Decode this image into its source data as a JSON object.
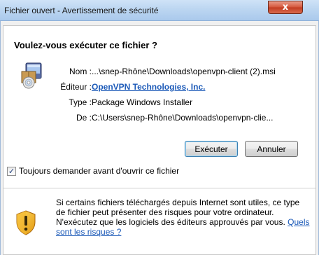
{
  "window": {
    "title": "Fichier ouvert - Avertissement de sécurité",
    "close_glyph": "x"
  },
  "dialog": {
    "heading": "Voulez-vous exécuter ce fichier ?",
    "app_icon": "installer-package-icon",
    "properties": [
      {
        "label": "Nom :",
        "value": "...\\snep-Rhône\\Downloads\\openvpn-client (2).msi"
      },
      {
        "label": "Éditeur :",
        "value": "OpenVPN Technologies, Inc."
      },
      {
        "label": "Type :",
        "value": "Package Windows Installer"
      },
      {
        "label": "De :",
        "value": "C:\\Users\\snep-Rhône\\Downloads\\openvpn-clie..."
      }
    ],
    "buttons": {
      "run": "Exécuter",
      "cancel": "Annuler"
    },
    "always_ask": {
      "label": "Toujours demander avant d'ouvrir ce fichier",
      "checked": true,
      "check_glyph": "✓"
    }
  },
  "warning": {
    "icon": "security-shield-icon",
    "lines": [
      "Si certains fichiers téléchargés depuis Internet sont utiles, ce type",
      "de fichier peut présenter des risques pour votre ordinateur.",
      "N'exécutez que les logiciels des éditeurs approuvés par vous."
    ],
    "link_part1": "Quels",
    "link_part2": "sont les risques ?"
  },
  "colors": {
    "link": "#1c5ab8",
    "titlebar": "#bcd6f1",
    "close_button": "#c23c22",
    "default_button_border": "#3c7fb1"
  }
}
